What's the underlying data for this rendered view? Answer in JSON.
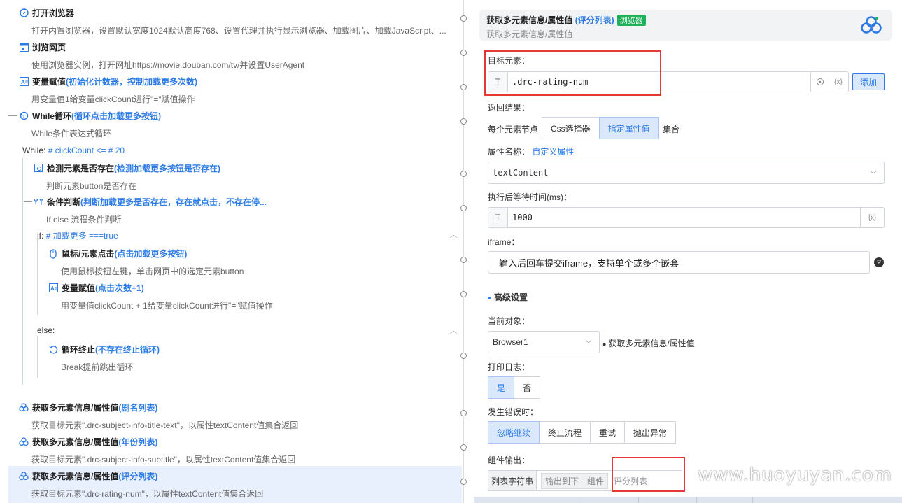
{
  "flow": {
    "steps": [
      {
        "title": "打开浏览器",
        "tag": "",
        "desc": "打开内置浏览器，设置默认宽度1024默认高度768、设置代理并执行显示浏览器、加载图片、加载JavaScript、...",
        "icon": "compass-icon"
      },
      {
        "title": "浏览网页",
        "tag": "",
        "desc": "使用浏览器实例，打开网址https://movie.douban.com/tv/并设置UserAgent",
        "icon": "browser-window-icon"
      },
      {
        "title": "变量赋值",
        "tag": "(初始化计数器，控制加载更多次数)",
        "desc": "用变量值1给变量clickCount进行\"=\"赋值操作",
        "icon": "variable-icon"
      },
      {
        "title": "While循环",
        "tag": "(循环点击加载更多按钮)",
        "desc": "While条件表达式循环",
        "icon": "loop-icon"
      },
      {
        "title": "检测元素是否存在",
        "tag": "(检测加载更多按钮是否存在)",
        "desc": "判断元素button是否存在",
        "icon": "detect-element-icon"
      },
      {
        "title": "条件判断",
        "tag": "(判断加载更多是否存在，存在就点击，不存在停...",
        "desc": "If else 流程条件判断",
        "icon": "branch-icon"
      },
      {
        "title": "鼠标/元素点击",
        "tag": "(点击加载更多按钮)",
        "desc": "使用鼠标按钮左键，单击网页中的选定元素button",
        "icon": "mouse-icon"
      },
      {
        "title": "变量赋值",
        "tag": "(点击次数+1)",
        "desc": "用变量值clickCount + 1给变量clickCount进行\"=\"赋值操作",
        "icon": "variable-icon"
      },
      {
        "title": "循环终止",
        "tag": "(不存在终止循环)",
        "desc": "Break提前跳出循环",
        "icon": "loop-break-icon"
      },
      {
        "title": "获取多元素信息/属性值",
        "tag": "(剧名列表)",
        "desc": "获取目标元素\".drc-subject-info-title-text\"，以属性textContent值集合返回",
        "icon": "elements-icon"
      },
      {
        "title": "获取多元素信息/属性值",
        "tag": "(年份列表)",
        "desc": "获取目标元素\".drc-subject-info-subtitle\"，以属性textContent值集合返回",
        "icon": "elements-icon"
      },
      {
        "title": "获取多元素信息/属性值",
        "tag": "(评分列表)",
        "desc": "获取目标元素\".drc-rating-num\"，以属性textContent值集合返回",
        "icon": "elements-icon"
      }
    ],
    "while_label": "While:",
    "while_expr": "# clickCount <= # 20",
    "if_label": "if:",
    "if_expr": "# 加载更多 ===true",
    "else_label": "else:"
  },
  "panel": {
    "title": "获取多元素信息/属性值",
    "title_tag": "(评分列表)",
    "badge": "浏览器",
    "subtitle": "获取多元素信息/属性值",
    "target_label": "目标元素：",
    "target_type": "T",
    "target_value": ".drc-rating-num",
    "target_fx": "{x}",
    "add_button": "添加",
    "return_label": "返回结果：",
    "each_node_label": "每个元素节点",
    "return_options": [
      "Css选择器",
      "指定属性值"
    ],
    "collection_label": "集合",
    "attr_label": "属性名称：",
    "attr_link": "自定义属性",
    "attr_value": "textContent",
    "wait_label": "执行后等待时间(ms)：",
    "wait_type": "T",
    "wait_value": "1000",
    "wait_fx": "{x}",
    "iframe_label": "iframe：",
    "iframe_placeholder": "输入后回车提交iframe，支持单个或多个嵌套",
    "advanced_label": "高级设置",
    "current_obj_label": "当前对象：",
    "current_obj_value": "Browser1",
    "current_obj_desc": "获取多元素信息/属性值",
    "log_label": "打印日志：",
    "log_options": [
      "是",
      "否"
    ],
    "error_label": "发生错误时：",
    "error_options": [
      "忽略继续",
      "终止流程",
      "重试",
      "抛出异常"
    ],
    "output_label": "组件输出：",
    "output_key": "列表字符串",
    "output_chip": "输出到下一组件",
    "output_value": "评分列表",
    "help_glyph": "?",
    "watermark": "www.huoyuyan.com"
  },
  "colors": {
    "accent": "#2d7be5",
    "badge": "#1fb05c",
    "highlight": "#e53935",
    "selected_row": "#e8effd"
  }
}
